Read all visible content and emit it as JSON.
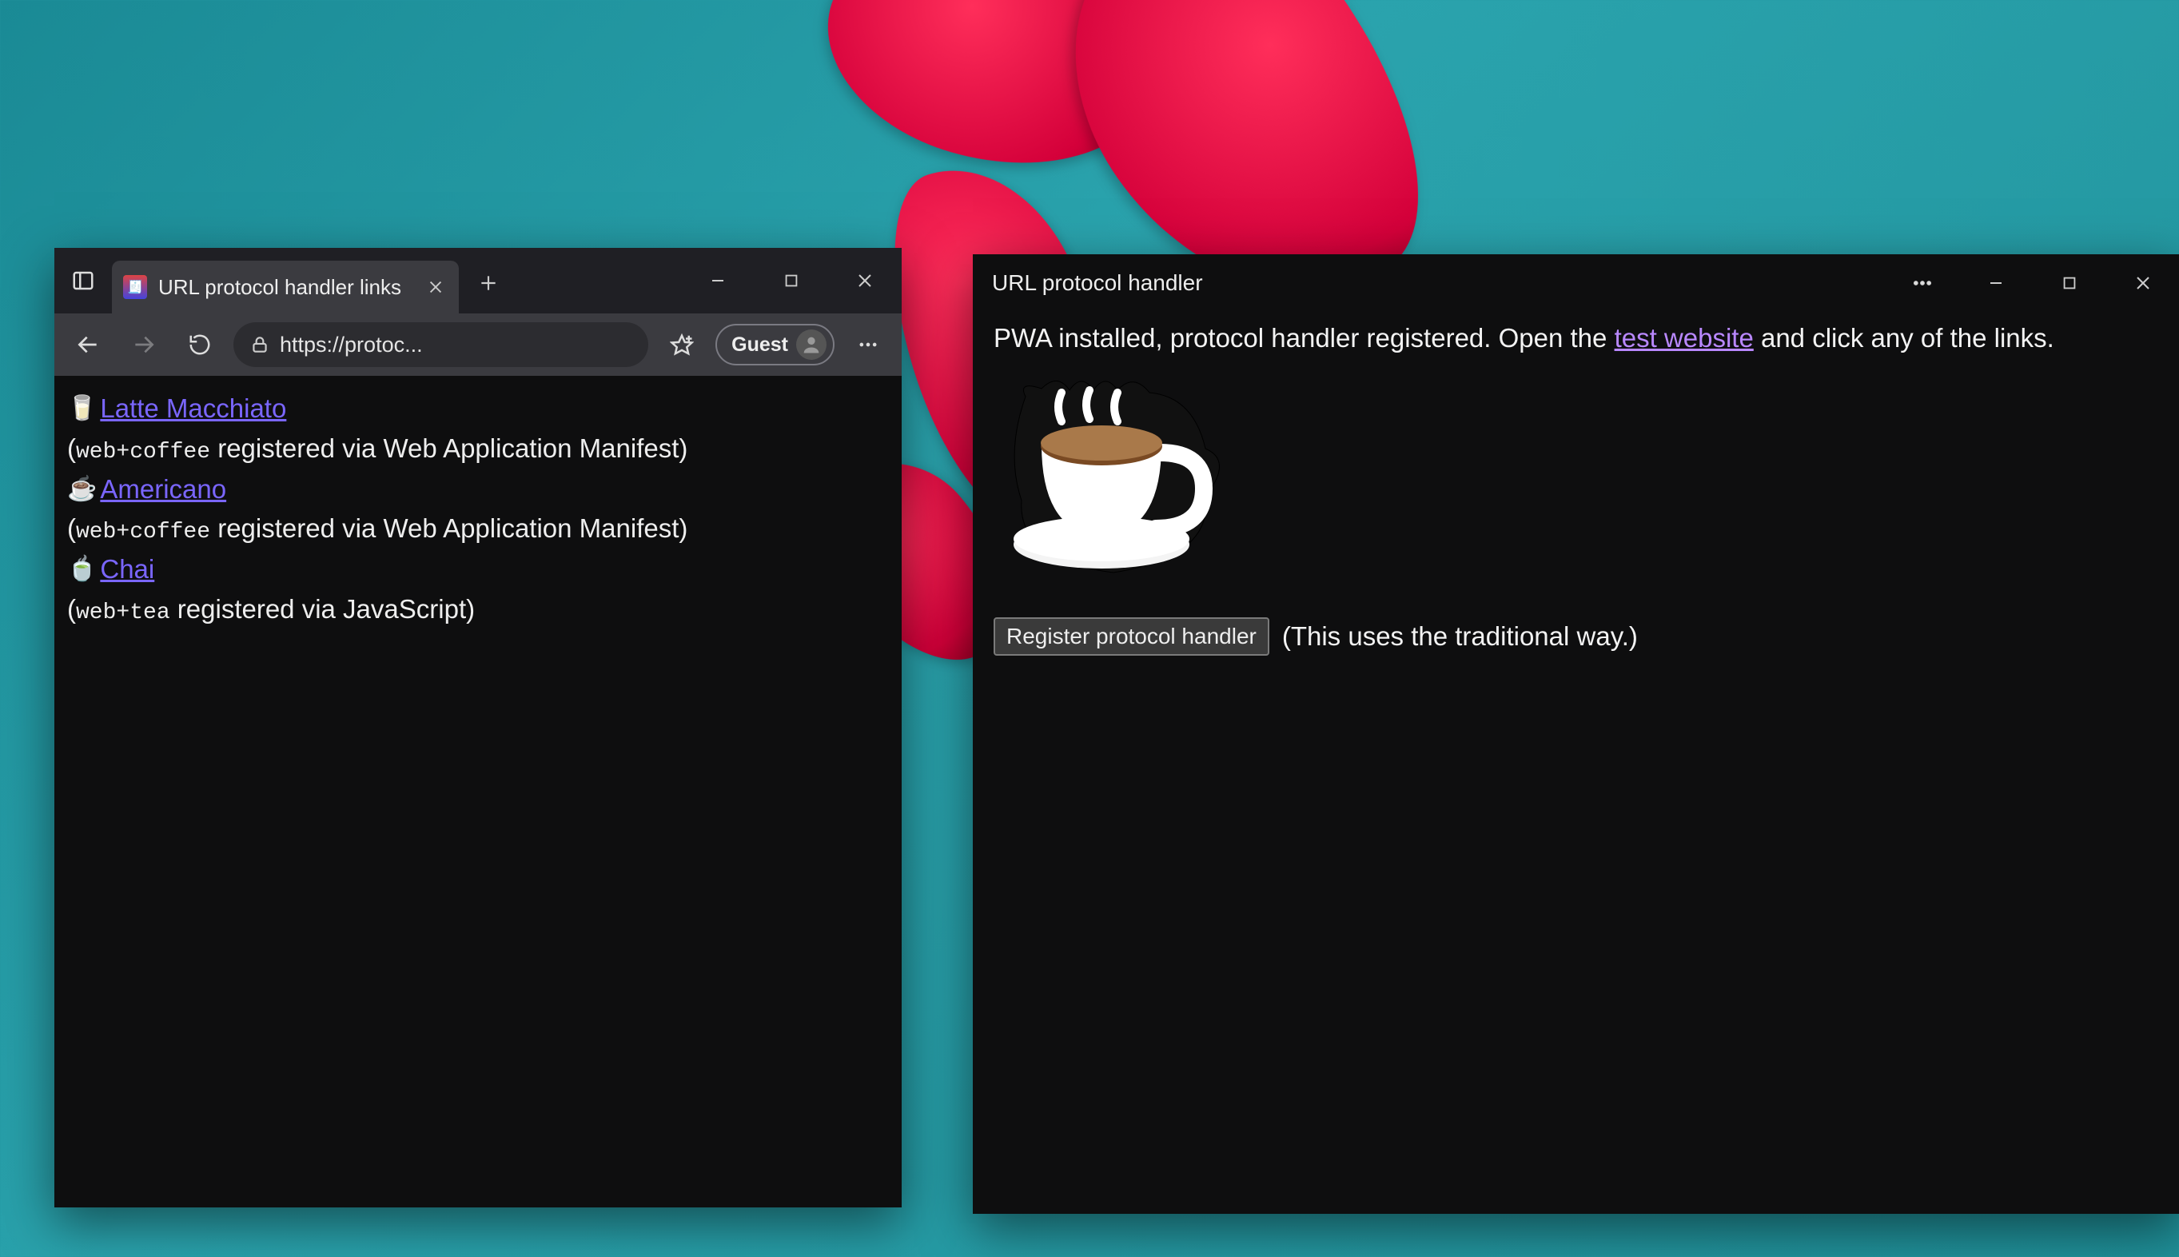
{
  "browser": {
    "tab_title": "URL protocol handler links",
    "address_url": "https://protoc...",
    "profile_label": "Guest",
    "links": [
      {
        "emoji": "🥛",
        "label": " Latte Macchiato",
        "protocol": "web+coffee",
        "via": " registered via Web Application Manifest)"
      },
      {
        "emoji": "☕",
        "label": " Americano",
        "protocol": "web+coffee",
        "via": " registered via Web Application Manifest)"
      },
      {
        "emoji": "🍵",
        "label": " Chai",
        "protocol": "web+tea",
        "via": " registered via JavaScript)"
      }
    ],
    "paren_open": "("
  },
  "pwa": {
    "title": "URL protocol handler",
    "status_prefix": "PWA installed, protocol handler registered. Open the ",
    "status_link": "test website",
    "status_suffix": " and click any of the links.",
    "register_button": "Register protocol handler",
    "register_note": "(This uses the traditional way.)"
  }
}
